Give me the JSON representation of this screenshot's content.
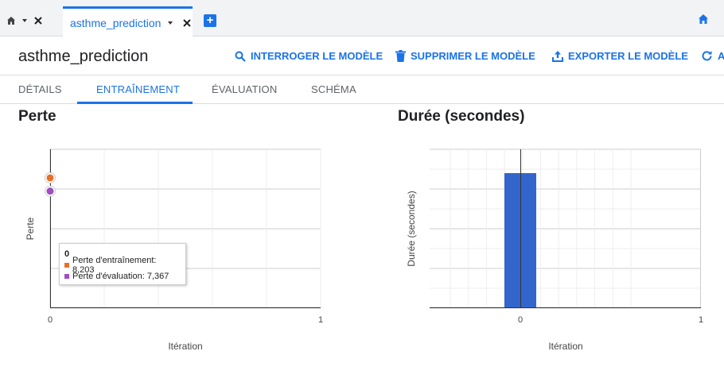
{
  "tabs": {
    "doc_tab_label": "asthme_prediction"
  },
  "header": {
    "title": "asthme_prediction",
    "actions": {
      "query": "INTERROGER LE MODÈLE",
      "delete": "SUPPRIMER LE MODÈLE",
      "export": "EXPORTER LE MODÈLE",
      "refresh": "AC"
    }
  },
  "subtabs": {
    "details": "DÉTAILS",
    "training": "ENTRAÎNEMENT",
    "evaluation": "ÉVALUATION",
    "schema": "SCHÉMA"
  },
  "colors": {
    "accent": "#1a73e8",
    "train_series": "#e8702a",
    "eval_series": "#9c4fbf",
    "bar": "#3366cc"
  },
  "chart_data": [
    {
      "type": "scatter",
      "title": "Perte",
      "xlabel": "Itération",
      "ylabel": "Perte",
      "xlim": [
        0,
        1
      ],
      "x_ticks": [
        "0",
        "1"
      ],
      "ylim": [
        0,
        10
      ],
      "grid": true,
      "series": [
        {
          "name": "Perte d'entraînement",
          "x": [
            0
          ],
          "values": [
            8.203
          ]
        },
        {
          "name": "Perte d'évaluation",
          "x": [
            0
          ],
          "values": [
            7.367
          ]
        }
      ],
      "tooltip": {
        "header": "0",
        "lines": [
          "Perte d'entraînement: 8,203",
          "Perte d'évaluation: 7,367"
        ]
      }
    },
    {
      "type": "bar",
      "title": "Durée (secondes)",
      "xlabel": "Itération",
      "ylabel": "Durée (secondes)",
      "categories": [
        "0"
      ],
      "x_ticks": [
        "0",
        "1"
      ],
      "values": [
        0.85
      ],
      "ylim": [
        0,
        1
      ],
      "grid": true
    }
  ]
}
